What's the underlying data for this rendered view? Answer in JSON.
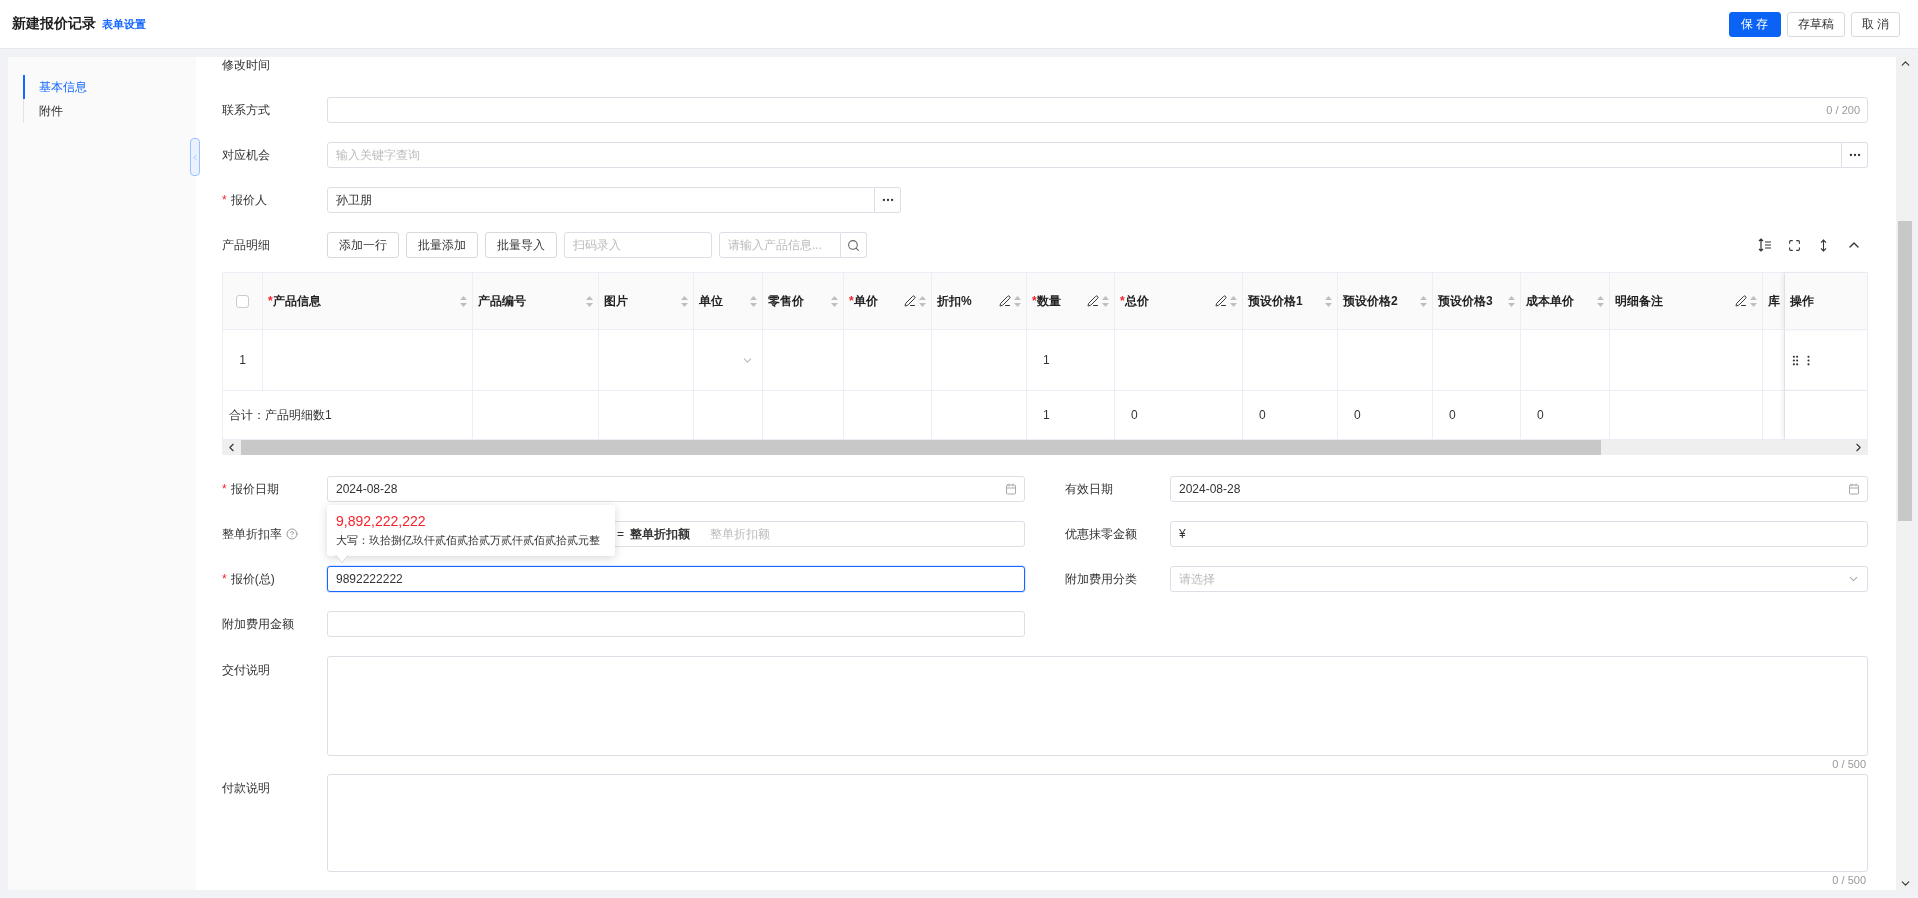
{
  "header": {
    "title": "新建报价记录",
    "link": "表单设置",
    "buttons": [
      {
        "label": "保 存",
        "kind": "primary"
      },
      {
        "label": "存草稿",
        "kind": "default"
      },
      {
        "label": "取 消",
        "kind": "default"
      }
    ]
  },
  "sidebar": {
    "items": [
      {
        "label": "基本信息",
        "selected": true
      },
      {
        "label": "附件",
        "selected": false
      }
    ]
  },
  "top_fields": [
    {
      "label": "修改时间",
      "kind": "label_only"
    },
    {
      "label": "联系方式",
      "kind": "counter_input",
      "counter": "0 / 200"
    },
    {
      "label": "对应机会",
      "kind": "lookup",
      "placeholder": "输入关键字查询"
    },
    {
      "label": "报价人",
      "required_mark": "*",
      "kind": "lookup_short",
      "value": "孙卫朋"
    }
  ],
  "products": {
    "label": "产品明细",
    "buttons": [
      "添加一行",
      "批量添加",
      "批量导入"
    ],
    "scan_placeholder": "扫码录入",
    "search_placeholder": "请输入产品信息...",
    "select_all": {
      "checked": false
    },
    "columns": [
      {
        "label": "产品信息",
        "required_mark": "*",
        "sortable": true,
        "editable": false
      },
      {
        "label": "产品编号",
        "sortable": true,
        "editable": false
      },
      {
        "label": "图片",
        "sortable": true,
        "editable": false
      },
      {
        "label": "单位",
        "sortable": true,
        "editable": false
      },
      {
        "label": "零售价",
        "sortable": true,
        "editable": false
      },
      {
        "label": "单价",
        "required_mark": "*",
        "sortable": true,
        "editable": true
      },
      {
        "label": "折扣%",
        "sortable": true,
        "editable": true
      },
      {
        "label": "数量",
        "required_mark": "*",
        "sortable": true,
        "editable": true
      },
      {
        "label": "总价",
        "required_mark": "*",
        "sortable": true,
        "editable": true
      },
      {
        "label": "预设价格1",
        "sortable": true,
        "editable": false
      },
      {
        "label": "预设价格2",
        "sortable": true,
        "editable": false
      },
      {
        "label": "预设价格3",
        "sortable": true,
        "editable": false
      },
      {
        "label": "成本单价",
        "sortable": true,
        "editable": false
      },
      {
        "label": "明细备注",
        "sortable": true,
        "editable": true
      },
      {
        "label": "库",
        "sortable": false,
        "editable": false
      },
      {
        "label": "操作",
        "sortable": false,
        "editable": false
      }
    ],
    "rows": [
      {
        "index": "1",
        "cells": [
          {
            "kind": "empty"
          },
          {
            "kind": "empty"
          },
          {
            "kind": "empty"
          },
          {
            "kind": "select"
          },
          {
            "kind": "empty"
          },
          {
            "kind": "empty"
          },
          {
            "kind": "empty"
          },
          {
            "kind": "text",
            "text": "1"
          },
          {
            "kind": "empty"
          },
          {
            "kind": "empty"
          },
          {
            "kind": "empty"
          },
          {
            "kind": "empty"
          },
          {
            "kind": "empty"
          },
          {
            "kind": "empty"
          },
          {
            "kind": "empty"
          },
          {
            "kind": "actions"
          }
        ]
      }
    ],
    "summary": {
      "label": "合计：产品明细数1",
      "cells": [
        {
          "kind": "empty"
        },
        {
          "kind": "empty"
        },
        {
          "kind": "empty"
        },
        {
          "kind": "empty"
        },
        {
          "kind": "empty"
        },
        {
          "kind": "empty"
        },
        {
          "kind": "text",
          "text": "1"
        },
        {
          "kind": "text",
          "text": "0"
        },
        {
          "kind": "text",
          "text": "0"
        },
        {
          "kind": "text",
          "text": "0"
        },
        {
          "kind": "text",
          "text": "0"
        },
        {
          "kind": "text",
          "text": "0"
        },
        {
          "kind": "empty"
        },
        {
          "kind": "empty"
        },
        {
          "kind": "empty"
        }
      ]
    }
  },
  "lower_rows": [
    [
      {
        "label": "报价日期",
        "required_mark": "*",
        "kind": "date",
        "value": "2024-08-28"
      },
      {
        "label": "有效日期",
        "kind": "date",
        "value": "2024-08-28"
      }
    ],
    [
      {
        "label": "整单折扣率",
        "help": true,
        "kind": "discount",
        "equals": "=",
        "amount_label": "整单折扣额",
        "placeholder": "整单折扣额"
      },
      {
        "label": "优惠抹零金额",
        "kind": "currency",
        "prefix": "¥"
      }
    ],
    [
      {
        "label": "报价(总)",
        "required_mark": "*",
        "kind": "input",
        "value": "9892222222",
        "focused": true,
        "tooltip": {
          "amount": "9,892,222,222",
          "words": "大写：玖拾捌亿玖仟贰佰贰拾贰万贰仟贰佰贰拾贰元整"
        }
      },
      {
        "label": "附加费用分类",
        "kind": "select",
        "placeholder": "请选择"
      }
    ],
    [
      {
        "label": "附加费用金额",
        "kind": "input",
        "focused": false
      }
    ],
    [
      {
        "label": "交付说明",
        "kind": "textarea",
        "counter": "0 / 500"
      }
    ],
    [
      {
        "label": "付款说明",
        "kind": "textarea",
        "counter": "0 / 500"
      }
    ]
  ]
}
